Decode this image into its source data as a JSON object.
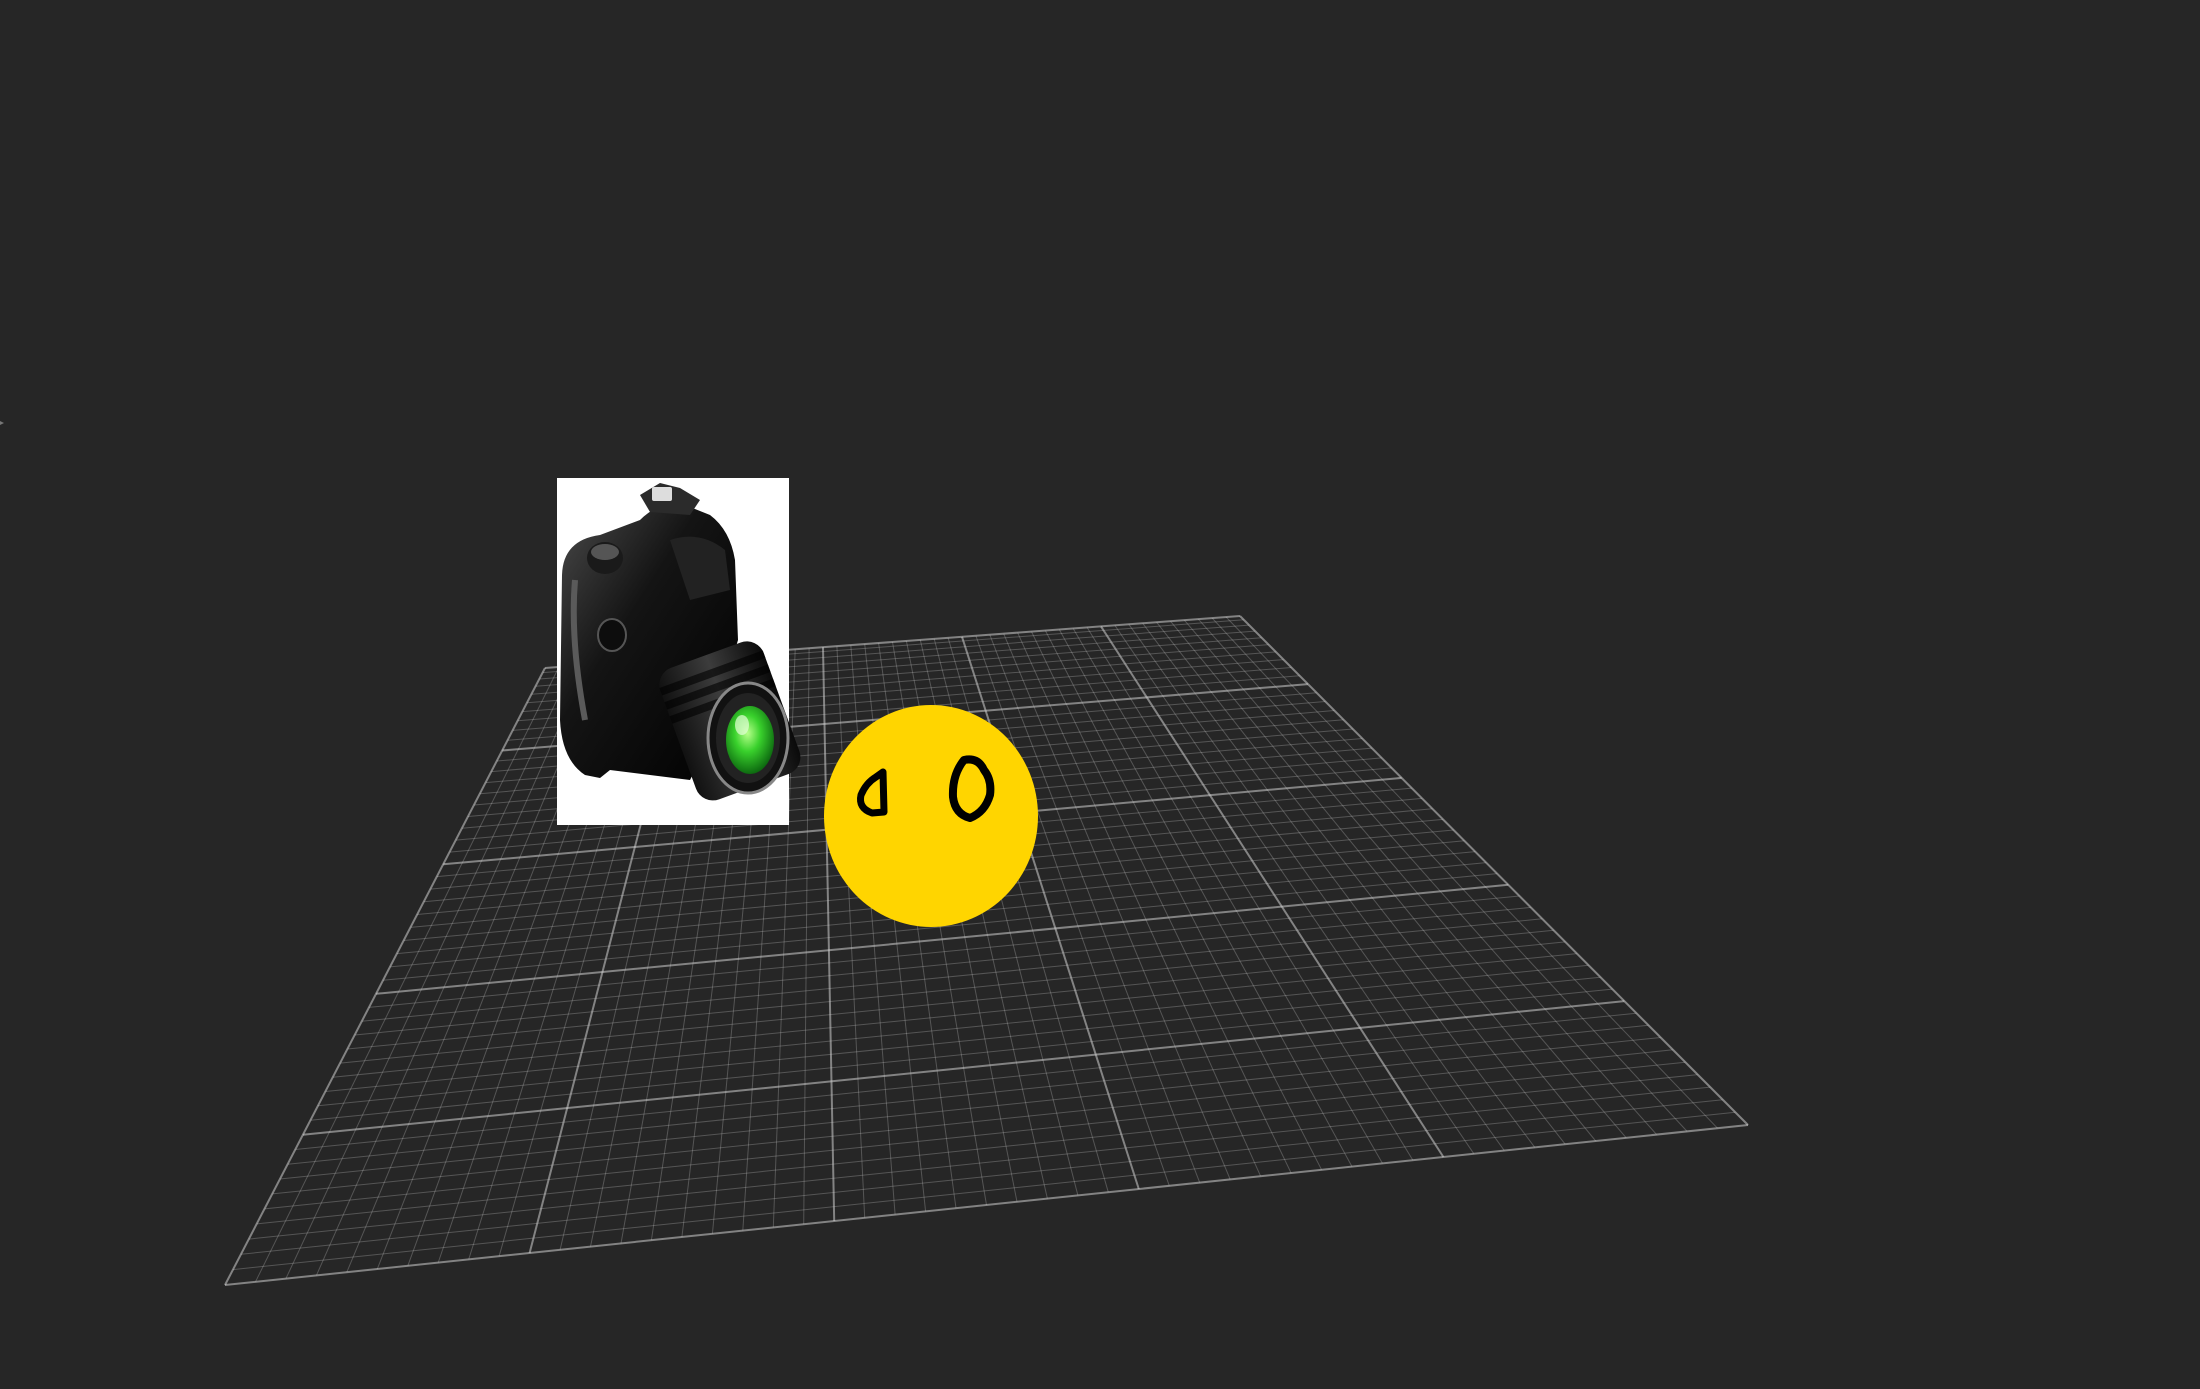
{
  "scene": {
    "background_color": "#262626",
    "floor_grid": {
      "major_divisions": 5,
      "minor_per_major": 10,
      "line_color": "#d0d0d0"
    },
    "objects": [
      {
        "name": "camera-sprite",
        "icon": "dslr-camera-icon",
        "lens_color": "#39d12c"
      },
      {
        "name": "smiley-sphere",
        "icon": "yellow-sphere-face-icon",
        "color": "#ffd500"
      }
    ]
  }
}
